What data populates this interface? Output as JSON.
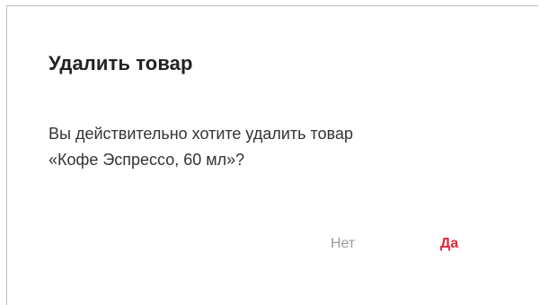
{
  "dialog": {
    "title": "Удалить товар",
    "message_line1": "Вы действительно хотите удалить товар",
    "message_line2": "«Кофе Эспрессо, 60 мл»?",
    "cancel_label": "Нет",
    "confirm_label": "Да"
  },
  "colors": {
    "confirm": "#e2263b",
    "cancel": "#9a9a9a",
    "title": "#222222",
    "text": "#333333",
    "border": "#c2c2c2"
  }
}
